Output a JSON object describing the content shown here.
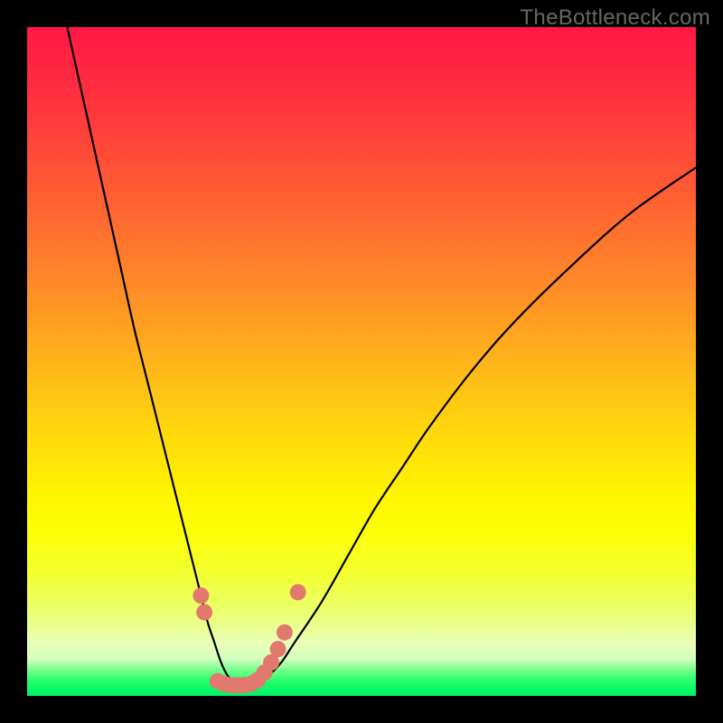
{
  "watermark": "TheBottleneck.com",
  "colors": {
    "frame": "#000000",
    "curve_stroke": "#000000",
    "marker_fill": "#e2796f",
    "watermark_text": "#676767"
  },
  "gradient_stops": [
    {
      "offset": 0.0,
      "color": "#ff1846"
    },
    {
      "offset": 0.1,
      "color": "#ff2f3f"
    },
    {
      "offset": 0.2,
      "color": "#ff4e37"
    },
    {
      "offset": 0.3,
      "color": "#ff6e2f"
    },
    {
      "offset": 0.4,
      "color": "#ff8f26"
    },
    {
      "offset": 0.5,
      "color": "#ffb41a"
    },
    {
      "offset": 0.6,
      "color": "#ffd60d"
    },
    {
      "offset": 0.7,
      "color": "#fff402"
    },
    {
      "offset": 0.76,
      "color": "#fcff09"
    },
    {
      "offset": 0.82,
      "color": "#f2ff32"
    },
    {
      "offset": 0.88,
      "color": "#eaff76"
    },
    {
      "offset": 0.92,
      "color": "#e9ffb6"
    },
    {
      "offset": 0.945,
      "color": "#d3ffbd"
    },
    {
      "offset": 0.96,
      "color": "#7eff90"
    },
    {
      "offset": 0.975,
      "color": "#30ff6f"
    },
    {
      "offset": 0.99,
      "color": "#09f868"
    },
    {
      "offset": 1.0,
      "color": "#07f066"
    }
  ],
  "chart_data": {
    "type": "line",
    "title": "",
    "xlabel": "",
    "ylabel": "",
    "xlim": [
      0,
      100
    ],
    "ylim": [
      0,
      100
    ],
    "grid": false,
    "legend": false,
    "series": [
      {
        "name": "bottleneck-curve",
        "x": [
          6,
          8,
          10,
          12,
          14,
          16,
          18,
          20,
          22,
          24,
          25,
          26,
          27,
          28,
          29,
          30,
          31,
          32,
          33,
          34,
          36,
          38,
          40,
          44,
          48,
          52,
          56,
          60,
          66,
          72,
          80,
          90,
          100
        ],
        "y": [
          100,
          91,
          82,
          73,
          64,
          55,
          47,
          39,
          31,
          23,
          19,
          15,
          11,
          8,
          5,
          3,
          2,
          1.5,
          1.5,
          2,
          3,
          5,
          8,
          14,
          21,
          28,
          34,
          40,
          48,
          55,
          63,
          72,
          79
        ]
      }
    ],
    "markers": [
      {
        "x": 26.0,
        "y": 15.0
      },
      {
        "x": 26.5,
        "y": 12.5
      },
      {
        "x": 28.5,
        "y": 2.2
      },
      {
        "x": 29.5,
        "y": 1.8
      },
      {
        "x": 30.5,
        "y": 1.6
      },
      {
        "x": 31.5,
        "y": 1.6
      },
      {
        "x": 32.5,
        "y": 1.6
      },
      {
        "x": 33.5,
        "y": 1.8
      },
      {
        "x": 34.5,
        "y": 2.4
      },
      {
        "x": 35.5,
        "y": 3.5
      },
      {
        "x": 36.5,
        "y": 5.0
      },
      {
        "x": 37.5,
        "y": 7.0
      },
      {
        "x": 38.5,
        "y": 9.5
      },
      {
        "x": 40.5,
        "y": 15.5
      }
    ]
  }
}
